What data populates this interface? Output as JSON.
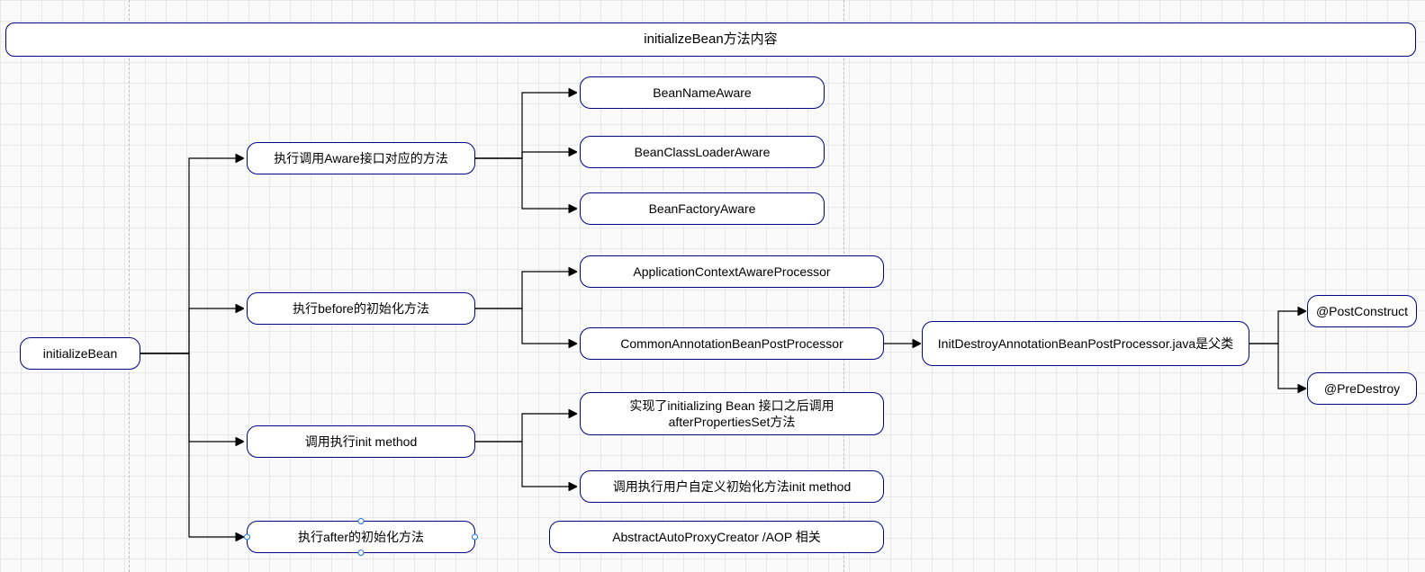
{
  "title": "initializeBean方法内容",
  "nodes": {
    "root": "initializeBean",
    "aware": "执行调用Aware接口对应的方法",
    "before": "执行before的初始化方法",
    "init": "调用执行init method",
    "after": "执行after的初始化方法",
    "beanNameAware": "BeanNameAware",
    "beanClassLoaderAware": "BeanClassLoaderAware",
    "beanFactoryAware": "BeanFactoryAware",
    "appCtxAwareProc": "ApplicationContextAwareProcessor",
    "commonAnnoProc": "CommonAnnotationBeanPostProcessor",
    "initDestroyProc": "InitDestroyAnnotationBeanPostProcessor.java是父类",
    "postConstruct": "@PostConstruct",
    "preDestroy": "@PreDestroy",
    "afterPropSet": "实现了initializing Bean 接口之后调用afterPropertiesSet方法",
    "customInit": "调用执行用户自定义初始化方法init method",
    "aopRelated": "AbstractAutoProxyCreator /AOP 相关"
  }
}
